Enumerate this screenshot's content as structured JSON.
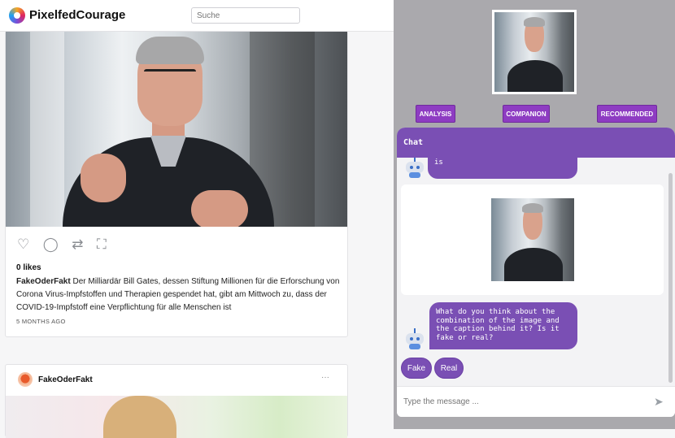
{
  "app": {
    "name": "PixelfedCourage",
    "logo_icon": "pixelfed-logo-icon"
  },
  "search": {
    "placeholder": "Suche"
  },
  "post1": {
    "likes": "0 likes",
    "author": "FakeOderFakt",
    "caption": "Der Milliardär Bill Gates, dessen Stiftung Millionen für die Erforschung von Corona Virus-Impfstoffen und Therapien gespendet hat, gibt am Mittwoch zu, dass der COVID-19-Impfstoff eine Verpflichtung für alle Menschen ist",
    "time_ago": "5 MONTHS AGO",
    "actions": [
      "heart-icon",
      "comment-icon",
      "share-icon",
      "expand-icon"
    ]
  },
  "post2": {
    "author": "FakeOderFakt",
    "more": "···"
  },
  "panel": {
    "tabs": [
      "ANALYSIS",
      "COMPANION",
      "RECOMMENDED"
    ],
    "chat_title": "Chat",
    "messages": {
      "m1": "Well done!! Your selected image is",
      "m2": "What do you think about the combination of the image and the caption behind it? Is it fake or real?"
    },
    "choices": [
      "Fake",
      "Real"
    ],
    "input_placeholder": "Type the message ...",
    "colors": {
      "accent": "#7a4fb4",
      "tab": "#8e3cc2"
    }
  }
}
